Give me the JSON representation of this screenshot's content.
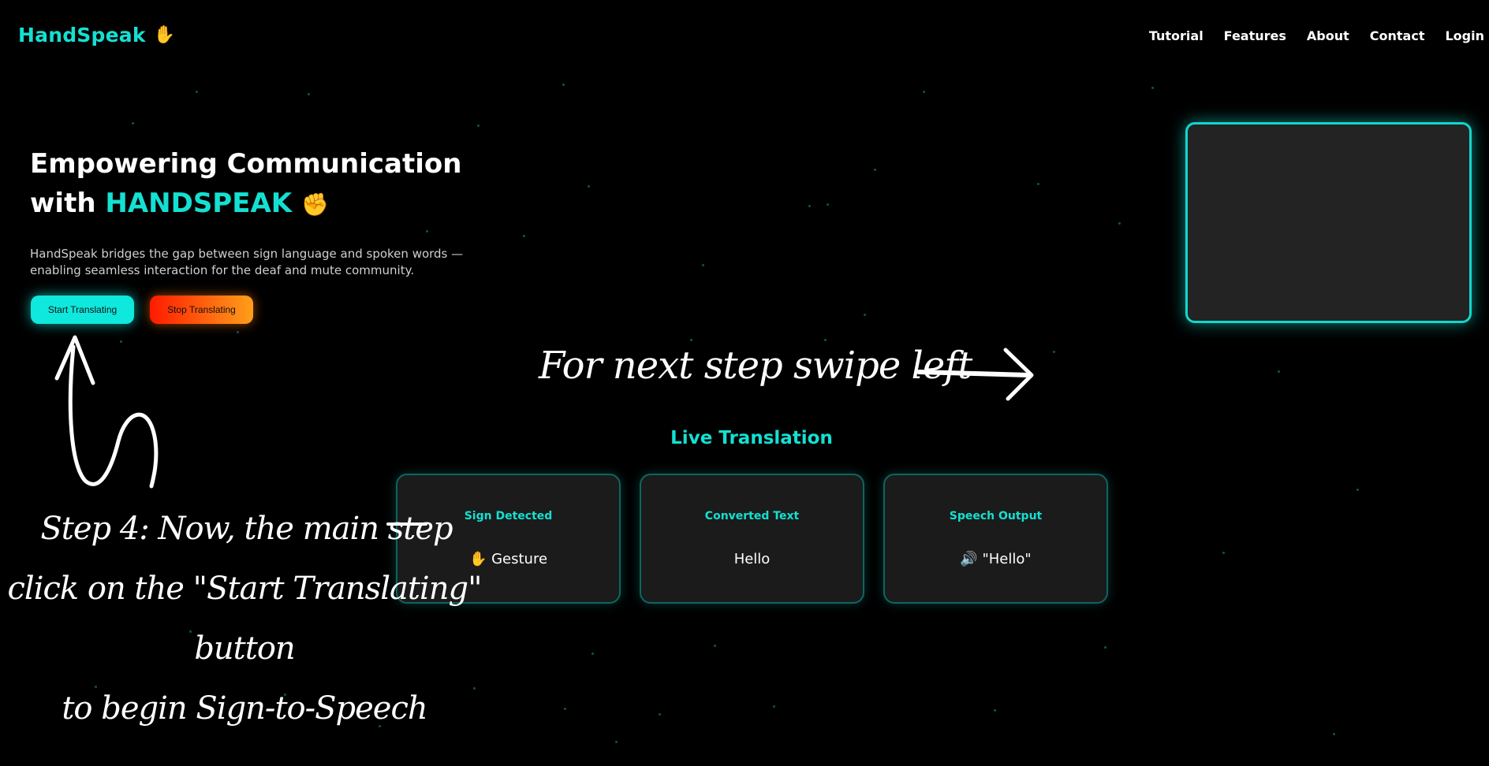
{
  "nav": {
    "brand": "HandSpeak",
    "brand_emoji": "✋",
    "links": [
      "Tutorial",
      "Features",
      "About",
      "Contact",
      "Login"
    ]
  },
  "hero": {
    "title_line1": "Empowering Communication",
    "title_with": "with",
    "title_accent": "HANDSPEAK",
    "title_emoji": "✊",
    "description": "HandSpeak bridges the gap between sign language and spoken words — enabling seamless interaction for the deaf and mute community.",
    "start_button": "Start Translating",
    "stop_button": "Stop Translating"
  },
  "live": {
    "title": "Live Translation",
    "cards": [
      {
        "title": "Sign Detected",
        "value": "✋ Gesture"
      },
      {
        "title": "Converted Text",
        "value": "Hello"
      },
      {
        "title": "Speech Output",
        "value": "🔊 \"Hello\""
      }
    ]
  },
  "annotations": {
    "swipe": "For next step swipe left",
    "step_line1": "Step 4: Now, the main step",
    "step_line2": "click on the \"Start Translating\" button",
    "step_line3": "to begin Sign-to-Speech"
  },
  "colors": {
    "accent": "#14e0d2",
    "background": "#000000",
    "stop_gradient_start": "#ff1a00",
    "stop_gradient_end": "#ff9f1a"
  }
}
